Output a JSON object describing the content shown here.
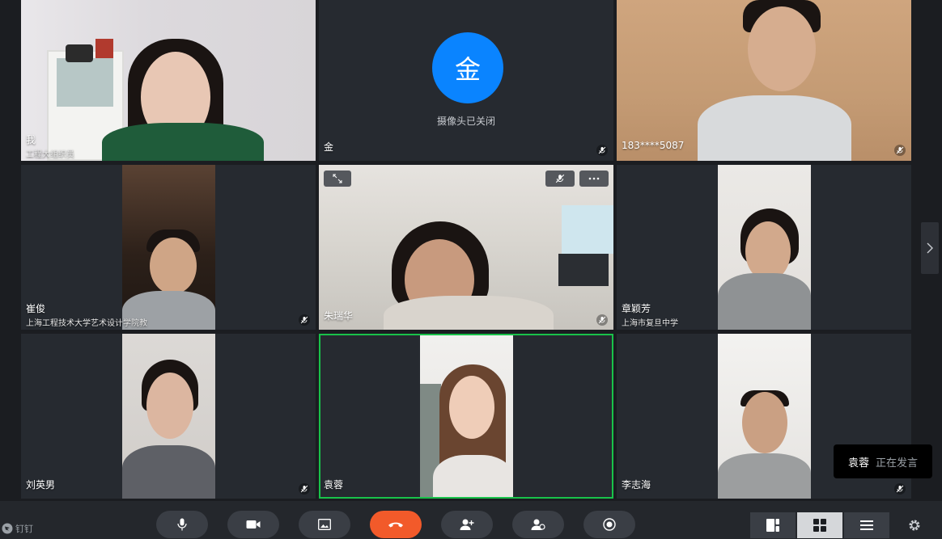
{
  "participants": {
    "p1": {
      "name": "我",
      "role": "工程大组织员"
    },
    "p2": {
      "name": "金",
      "avatar_char": "金",
      "status": "摄像头已关闭"
    },
    "p3": {
      "name": "183****5087"
    },
    "p4": {
      "name": "崔俊",
      "org": "上海工程技术大学艺术设计学院教"
    },
    "p5": {
      "name": "朱瑞华"
    },
    "p6": {
      "name": "章颖芳",
      "org": "上海市复旦中学"
    },
    "p7": {
      "name": "刘英男"
    },
    "p8": {
      "name": "袁蓉"
    },
    "p9": {
      "name": "李志海"
    }
  },
  "speaking": {
    "name": "袁蓉",
    "label": "正在发言"
  },
  "brand": "钉钉",
  "toolbar": {
    "buttons": [
      "mic-icon",
      "camera-icon",
      "screen-share-icon",
      "hangup-icon",
      "add-member-icon",
      "member-manage-icon",
      "record-icon"
    ],
    "layouts": [
      "speaker-layout-icon",
      "grid-layout-icon",
      "list-layout-icon"
    ],
    "active_layout": "grid-layout-icon"
  },
  "colors": {
    "accent": "#0a84ff",
    "hangup": "#f25a2a",
    "active_speaker_border": "#19c24a",
    "background": "#1b1d21",
    "tile": "#262a30"
  }
}
